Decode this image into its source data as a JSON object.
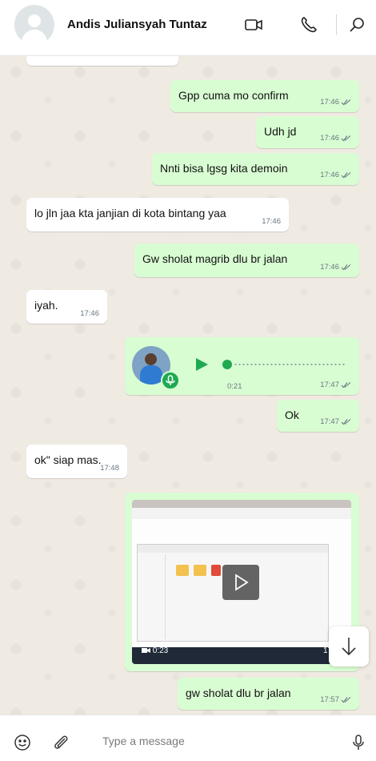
{
  "header": {
    "contact_name": "Andis Juliansyah Tuntaz",
    "icons": [
      "video-call-icon",
      "voice-call-icon",
      "search-icon"
    ]
  },
  "messages": [
    {
      "dir": "out",
      "text": "Gpp cuma mo confirm",
      "time": "17:46"
    },
    {
      "dir": "out",
      "text": "Udh jd",
      "time": "17:46"
    },
    {
      "dir": "out",
      "text": "Nnti bisa lgsg kita demoin",
      "time": "17:46"
    },
    {
      "dir": "in",
      "text": "lo jln jaa kta janjian di kota bintang yaa",
      "time": "17:46"
    },
    {
      "dir": "out",
      "text": "Gw sholat magrib dlu br jalan",
      "time": "17:46"
    },
    {
      "dir": "in",
      "text": "iyah.",
      "time": "17:46"
    },
    {
      "dir": "out",
      "type": "voice",
      "duration": "0:21",
      "time": "17:47"
    },
    {
      "dir": "out",
      "text": "Ok",
      "time": "17:47"
    },
    {
      "dir": "in",
      "text": "ok\" siap mas.",
      "time": "17:48"
    },
    {
      "dir": "out",
      "type": "video",
      "duration": "0:23",
      "time": "17:55"
    },
    {
      "dir": "out",
      "text": "gw sholat dlu br jalan",
      "time": "17:57"
    }
  ],
  "composer": {
    "placeholder": "Type a message"
  },
  "colors": {
    "outgoing_bubble": "#d9fdd3",
    "incoming_bubble": "#ffffff",
    "accent": "#1ea952",
    "chat_bg": "#efeae2"
  }
}
